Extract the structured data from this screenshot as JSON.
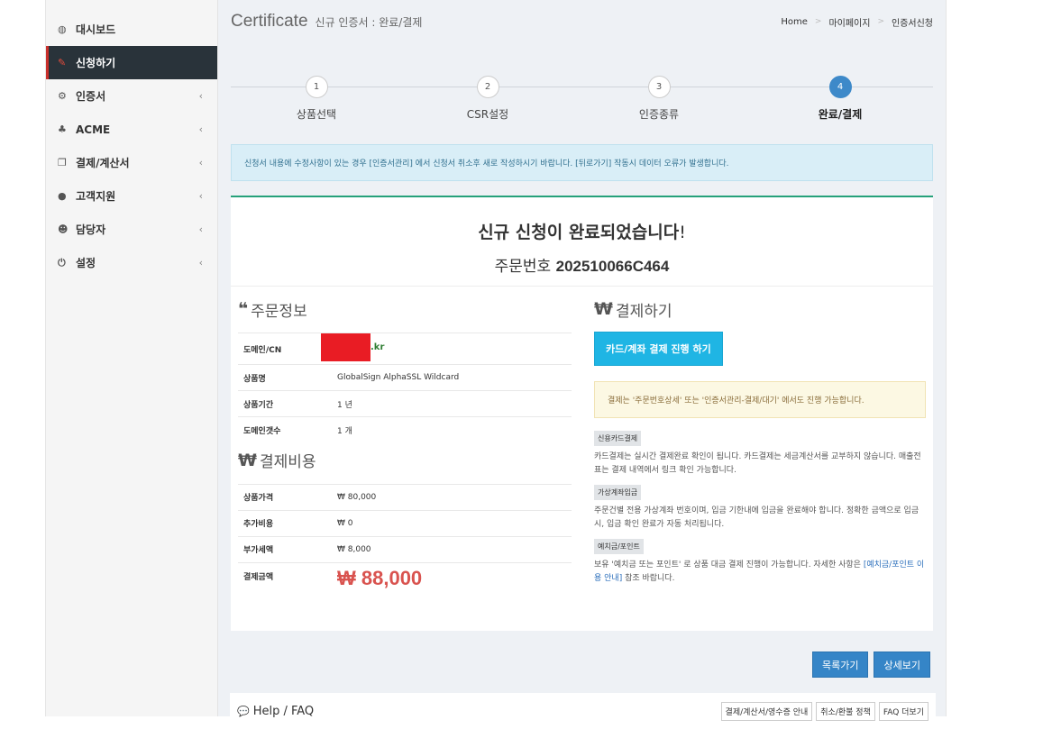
{
  "sidebar": {
    "items": [
      {
        "label": "대시보드",
        "icon": "dashboard-icon",
        "glyph": "◍"
      },
      {
        "label": "신청하기",
        "icon": "edit-icon",
        "glyph": "✎",
        "active": true
      },
      {
        "label": "인증서",
        "icon": "cogs-icon",
        "glyph": "⚙"
      },
      {
        "label": "ACME",
        "icon": "sitemap-icon",
        "glyph": "♣"
      },
      {
        "label": "결제/계산서",
        "icon": "copy-icon",
        "glyph": "❐"
      },
      {
        "label": "고객지원",
        "icon": "comments-icon",
        "glyph": "●"
      },
      {
        "label": "담당자",
        "icon": "users-icon",
        "glyph": "☻"
      },
      {
        "label": "설정",
        "icon": "power-icon",
        "glyph": "⏻"
      }
    ],
    "chevron": "‹"
  },
  "header": {
    "title": "Certificate",
    "subtitle": "신규 인증서 : 완료/결제",
    "breadcrumb": [
      "Home",
      "마이페이지",
      "인증서신청"
    ],
    "sep": ">"
  },
  "steps": [
    {
      "num": "1",
      "label": "상품선택"
    },
    {
      "num": "2",
      "label": "CSR설정"
    },
    {
      "num": "3",
      "label": "인증종류"
    },
    {
      "num": "4",
      "label": "완료/결제"
    }
  ],
  "notice": "신청서 내용에 수정사항이 있는 경우 [인증서관리] 에서 신청서 취소후 새로 작성하시기 바랍니다. [뒤로가기] 작동시 데이터 오류가 발생합니다.",
  "result": {
    "title": "신규 신청이 완료되었습니다",
    "bang": "!",
    "order_label": "주문번호",
    "order_no": "202510066C464"
  },
  "order_info": {
    "heading": "주문정보",
    "quote": "❝",
    "rows": [
      {
        "k": "도메인/CN",
        "v": ".kr"
      },
      {
        "k": "상품명",
        "v": "GlobalSign AlphaSSL Wildcard"
      },
      {
        "k": "상품기간",
        "v": "1 년"
      },
      {
        "k": "도메인갯수",
        "v": "1 개"
      }
    ]
  },
  "cost": {
    "heading": "결제비용",
    "won": "₩",
    "rows": [
      {
        "k": "상품가격",
        "v": "₩ 80,000"
      },
      {
        "k": "추가비용",
        "v": "₩ 0"
      },
      {
        "k": "부가세액",
        "v": "₩ 8,000"
      }
    ],
    "total_label": "결제금액",
    "total": "₩ 88,000"
  },
  "payment": {
    "heading": "결제하기",
    "button": "카드/계좌 결제 진행 하기",
    "warn": "결제는 '주문번호상세' 또는 '인증서관리-결제/대기' 에서도 진행 가능합니다.",
    "methods": [
      {
        "tag": "신용카드결제",
        "desc": "카드결제는 실시간 결제완료 확인이 됩니다. 카드결제는 세금계산서를 교부하지 않습니다. 매출전표는 결제 내역에서 링크 확인 가능합니다."
      },
      {
        "tag": "가상계좌입금",
        "desc": "주문건별 전용 가상계좌 번호이며, 입금 기한내에 입금을 완료해야 합니다. 정확한 금액으로 입금시, 입금 확인 완료가 자동 처리됩니다."
      },
      {
        "tag": "예치금/포인트",
        "desc_pre": "보유 '예치금 또는 포인트' 로 상품 대금 결제 진행이 가능합니다. 자세한 사항은 ",
        "desc_link": "[예치금/포인트 이용 안내]",
        "desc_post": " 참조 바랍니다."
      }
    ]
  },
  "actions": {
    "list": "목록가기",
    "detail": "상세보기"
  },
  "faq": {
    "title": "Help / FAQ",
    "icon_glyph": "💬",
    "buttons": [
      "결제/계산서/영수증 안내",
      "취소/환불 정책",
      "FAQ 더보기"
    ]
  },
  "colors": {
    "accent": "#3585c7",
    "active_nav": "#29333a",
    "total": "#d9534f",
    "pay_button": "#1fb5e4"
  }
}
